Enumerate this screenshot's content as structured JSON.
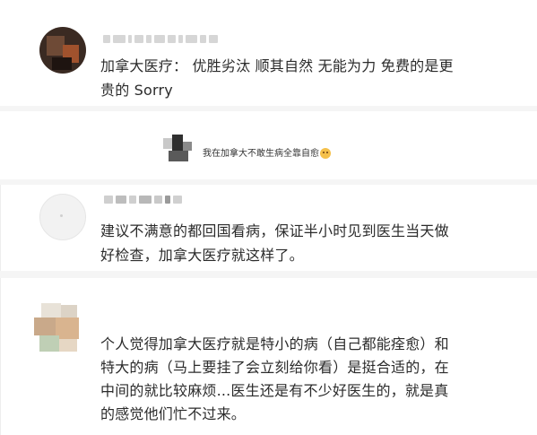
{
  "comments": [
    {
      "lines": [
        "加拿大医疗：  优胜劣汰 顺其自然 无能为力 免费的是更",
        "贵的 Sorry"
      ]
    },
    {
      "text": "我在加拿大不敢生病全靠自愈",
      "emoji_icon": "emoji-face-icon"
    },
    {
      "lines": [
        "建议不满意的都回国看病，保证半小时见到医生当天做",
        "好检查，加拿大医疗就这样了。"
      ]
    },
    {
      "lines": [
        "个人觉得加拿大医疗就是特小的病（自己都能痊愈）和",
        "特大的病（马上要挂了会立刻给你看）是挺合适的，在",
        "中间的就比较麻烦...医生还是有不少好医生的，就是真",
        "的感觉他们忙不过来。"
      ]
    }
  ]
}
